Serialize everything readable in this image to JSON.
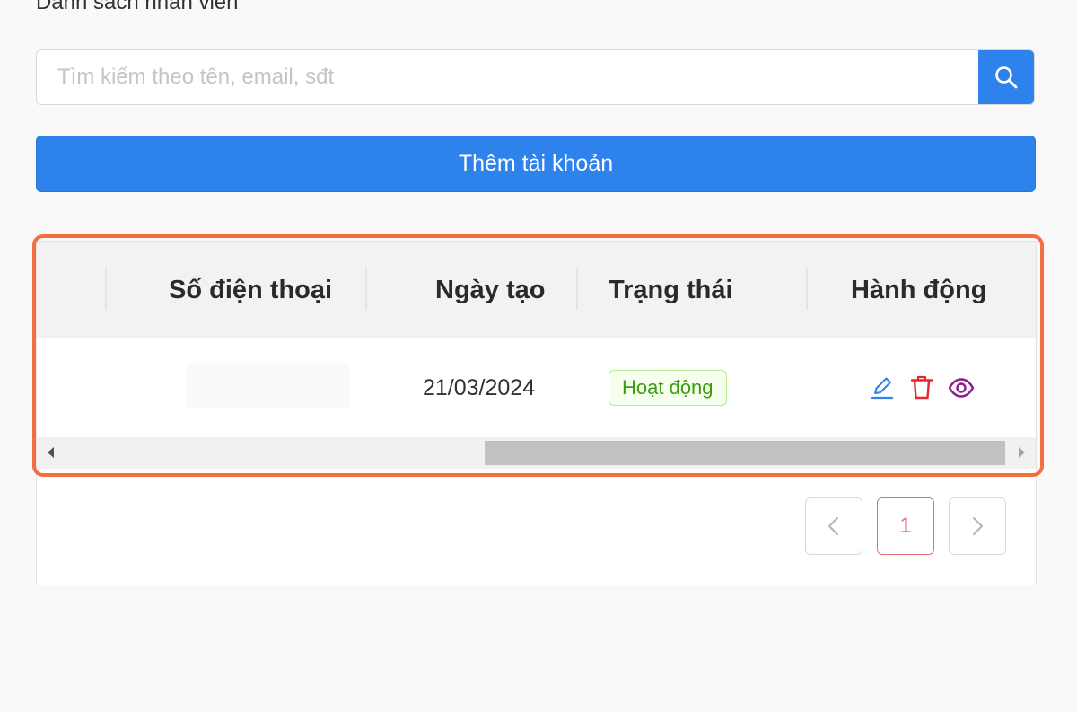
{
  "page": {
    "title": "Danh sách nhân viên"
  },
  "search": {
    "placeholder": "Tìm kiếm theo tên, email, sđt",
    "value": "",
    "button_icon": "search-icon"
  },
  "add_button": {
    "label": "Thêm tài khoản"
  },
  "table": {
    "columns": [
      "Số điện thoại",
      "Ngày tạo",
      "Trạng thái",
      "Hành động"
    ],
    "rows": [
      {
        "phone": "",
        "created_date": "21/03/2024",
        "status": "Hoạt động",
        "actions": [
          "edit-icon",
          "delete-icon",
          "view-icon"
        ]
      }
    ]
  },
  "pagination": {
    "current_page": "1",
    "prev_icon": "chevron-left-icon",
    "next_icon": "chevron-right-icon"
  },
  "colors": {
    "primary": "#2d82ec",
    "highlight_border": "#f26f3f",
    "status_text": "#389e0d",
    "status_bg": "#f6ffed",
    "edit_icon": "#2d82ec",
    "delete_icon": "#e5262c",
    "view_icon": "#8b1b8e",
    "active_page": "#e2727a"
  }
}
